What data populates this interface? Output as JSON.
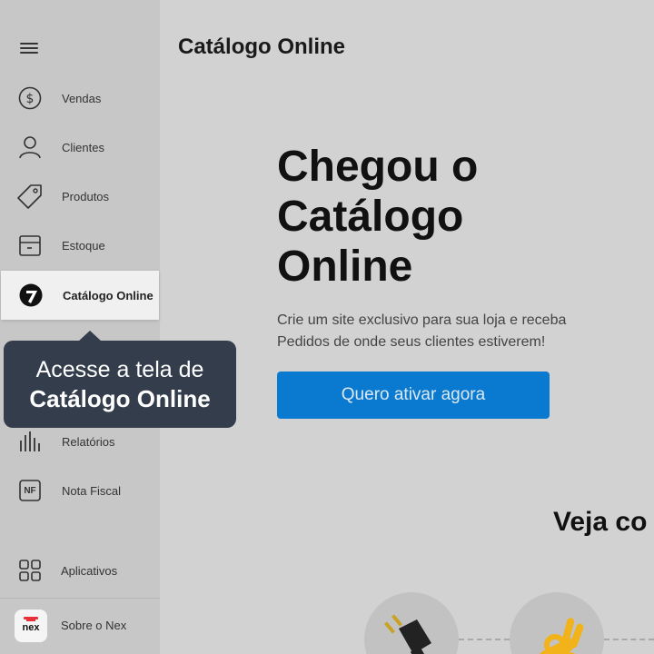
{
  "sidebar": {
    "items": [
      {
        "label": "Vendas",
        "icon": "dollar-icon"
      },
      {
        "label": "Clientes",
        "icon": "user-icon"
      },
      {
        "label": "Produtos",
        "icon": "tag-icon"
      },
      {
        "label": "Estoque",
        "icon": "box-icon"
      },
      {
        "label": "Catálogo Online",
        "icon": "catalog-icon",
        "active": true
      },
      {
        "label": "Relatórios",
        "icon": "bars-icon"
      },
      {
        "label": "Nota Fiscal",
        "icon": "nf-icon",
        "badge": "NF"
      }
    ],
    "apps": {
      "label": "Aplicativos",
      "icon": "grid-icon"
    },
    "about": {
      "label": "Sobre o Nex",
      "logo": "nex"
    }
  },
  "main": {
    "title": "Catálogo Online",
    "hero_title": "Chegou o Catálogo Online",
    "hero_text": "Crie um site exclusivo para sua loja e receba Pedidos de onde seus clientes estiverem!",
    "cta_label": "Quero ativar agora",
    "section_heading": "Veja co"
  },
  "tooltip": {
    "line1": "Acesse a tela de",
    "line2": "Catálogo Online"
  },
  "colors": {
    "primary": "#0a7ad0",
    "tooltip_bg": "#333d4c",
    "brand": "#e8303a",
    "sidebar_bg": "#c7c7c7",
    "main_bg": "#d2d2d2"
  }
}
